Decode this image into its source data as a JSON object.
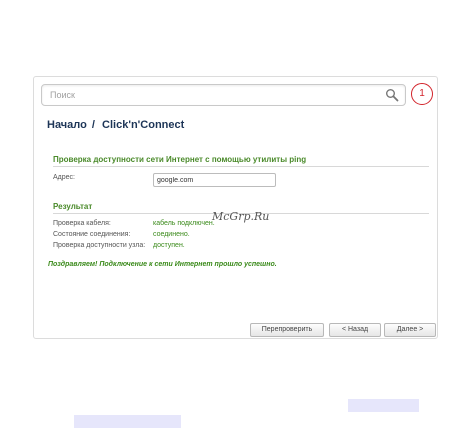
{
  "search": {
    "placeholder": "Поиск"
  },
  "callout_number": "1",
  "breadcrumb": {
    "home": "Начало",
    "separator": "/",
    "current": "Click'n'Connect"
  },
  "ping_section": {
    "title": "Проверка доступности сети Интернет с помощью утилиты ping",
    "address_label": "Адрес:",
    "address_value": "google.com"
  },
  "result_section": {
    "title": "Результат",
    "rows": [
      {
        "label": "Проверка кабеля:",
        "value": "кабель подключен."
      },
      {
        "label": "Состояние соединения:",
        "value": "соединено."
      },
      {
        "label": "Проверка доступности узла:",
        "value": "доступен."
      }
    ],
    "success_message": "Поздравляем! Подключение к сети Интернет прошло успешно."
  },
  "buttons": {
    "recheck": "Перепроверить",
    "back": "< Назад",
    "next": "Далее >"
  },
  "watermark": "McGrp.Ru",
  "colors": {
    "accent_green": "#4a8a2a",
    "title_navy": "#1d3557",
    "callout_red": "#d2232a"
  },
  "icons": {
    "search": "magnifier-icon"
  }
}
